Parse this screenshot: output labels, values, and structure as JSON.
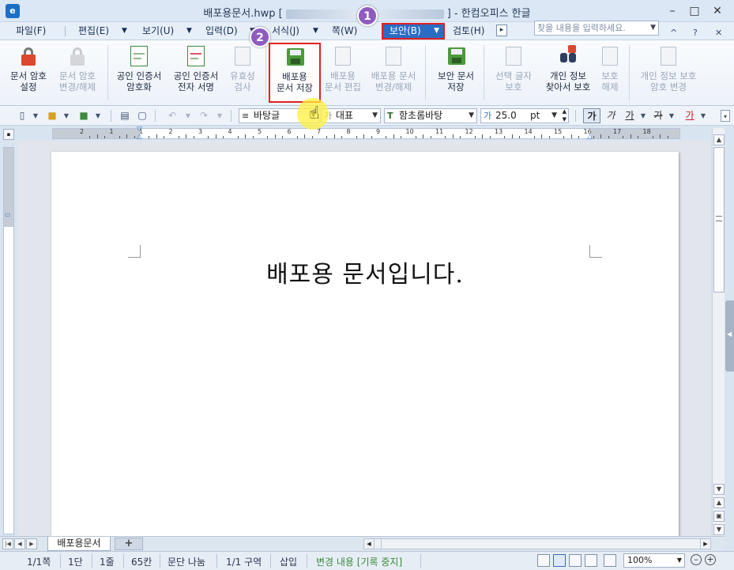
{
  "window": {
    "app_icon": "e",
    "title_prefix": "배포용문서.hwp [",
    "title_suffix": "] - 한컴오피스 한글",
    "minimize": "–",
    "maximize": "□",
    "close": "✕"
  },
  "menu": {
    "items": [
      "파일(F)",
      "편집(E)",
      "보기(U)",
      "입력(D)",
      "서식(J)",
      "쪽(W)",
      "보안(B)",
      "검토(H)"
    ],
    "more_icon": "▸",
    "search_placeholder": "찾을 내용을 입력하세요.",
    "ribbon_collapse": "^",
    "help": "?",
    "close_doc": "✕"
  },
  "ribbon": {
    "doc_password": "문서 암호\n설정",
    "doc_password_release": "문서 암호\n변경/해제",
    "cert_encrypt": "공인 인증서\n암호화",
    "cert_sign": "공인 인증서\n전자 서명",
    "validity_check": "유효성\n검사",
    "dist_save": "배포용\n문서 저장",
    "dist_edit": "배포용\n문서 편집",
    "dist_release": "배포용 문서\n변경/해제",
    "security_save": "보안 문서\n저장",
    "char_protect": "선택 글자\n보호",
    "find_privacy": "개인 정보\n찾아서 보호",
    "protect_release": "보호\n해제",
    "privacy_password": "개인 정보 보호\n암호 변경"
  },
  "toolbar": {
    "style": "바탕글",
    "lang_prefix": "가",
    "lang": "대표",
    "font_prefix": "T",
    "font": "함초롬바탕",
    "size_prefix": "가",
    "size": "25.0",
    "unit": "pt",
    "bold": "가",
    "italic": "가",
    "underline": "가",
    "strike": "가",
    "color": "가"
  },
  "ruler": {
    "numbers": [
      "2",
      "1",
      "1",
      "2",
      "3",
      "4",
      "5",
      "6",
      "7",
      "8",
      "9",
      "10",
      "11",
      "12",
      "13",
      "14",
      "15",
      "16",
      "17",
      "18"
    ]
  },
  "document": {
    "text": "배포용 문서입니다."
  },
  "tabs": {
    "doc_tab": "배포용문서",
    "add": "+"
  },
  "status": {
    "page": "1/1쪽",
    "column": "1단",
    "line": "1줄",
    "col_pos": "65칸",
    "paragraph": "문단 나눔",
    "section": "1/1 구역",
    "insert": "삽입",
    "track": "변경 내용 [기록 중지]",
    "zoom": "100%"
  },
  "annotations": {
    "step1": "1",
    "step2": "2"
  },
  "colors": {
    "highlight_box": "#e02020",
    "menu_active": "#2b6cc4",
    "badge": "#8e5cbf"
  }
}
